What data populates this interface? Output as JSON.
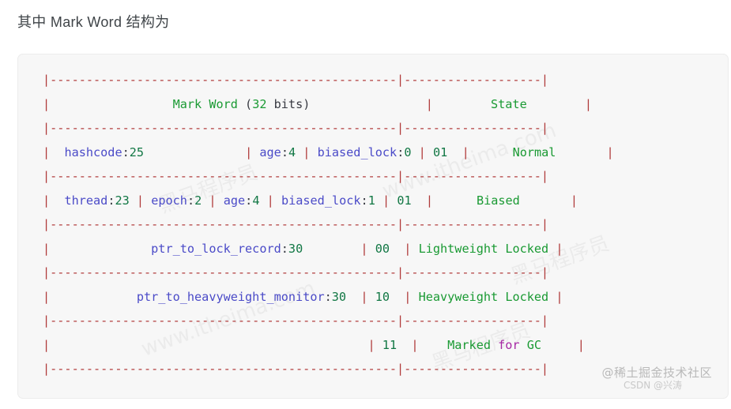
{
  "heading": "其中 Mark Word 结构为",
  "code_block": {
    "language": "text",
    "rule_char": "|",
    "separator_line": "|------------------------------------------------|-------------------|",
    "lines": [
      {
        "id": "rule-top",
        "type": "rule",
        "text": "|------------------------------------------------|-------------------|"
      },
      {
        "id": "header",
        "type": "content",
        "tokens": [
          {
            "text": "|",
            "color": "rule"
          },
          {
            "text": "                 ",
            "color": "punct"
          },
          {
            "text": "Mark Word ",
            "color": "str"
          },
          {
            "text": "(",
            "color": "punct"
          },
          {
            "text": "32",
            "color": "str"
          },
          {
            "text": " bits)",
            "color": "punct"
          },
          {
            "text": "                ",
            "color": "punct"
          },
          {
            "text": "|",
            "color": "rule"
          },
          {
            "text": "        ",
            "color": "punct"
          },
          {
            "text": "State",
            "color": "str"
          },
          {
            "text": "        ",
            "color": "punct"
          },
          {
            "text": "|",
            "color": "rule"
          }
        ]
      },
      {
        "id": "rule-1",
        "type": "rule",
        "text": "|------------------------------------------------|-------------------|"
      },
      {
        "id": "row-normal",
        "type": "content",
        "tokens": [
          {
            "text": "| ",
            "color": "rule"
          },
          {
            "text": " hashcode",
            "color": "ident"
          },
          {
            "text": ":",
            "color": "punct"
          },
          {
            "text": "25",
            "color": "num"
          },
          {
            "text": "              ",
            "color": "punct"
          },
          {
            "text": "|",
            "color": "rule"
          },
          {
            "text": " ",
            "color": "punct"
          },
          {
            "text": "age",
            "color": "ident"
          },
          {
            "text": ":",
            "color": "punct"
          },
          {
            "text": "4",
            "color": "num"
          },
          {
            "text": " ",
            "color": "punct"
          },
          {
            "text": "|",
            "color": "rule"
          },
          {
            "text": " ",
            "color": "punct"
          },
          {
            "text": "biased_lock",
            "color": "ident"
          },
          {
            "text": ":",
            "color": "punct"
          },
          {
            "text": "0",
            "color": "num"
          },
          {
            "text": " ",
            "color": "punct"
          },
          {
            "text": "|",
            "color": "rule"
          },
          {
            "text": " ",
            "color": "punct"
          },
          {
            "text": "01",
            "color": "num"
          },
          {
            "text": "  ",
            "color": "punct"
          },
          {
            "text": "|",
            "color": "rule"
          },
          {
            "text": "      ",
            "color": "punct"
          },
          {
            "text": "Normal",
            "color": "str"
          },
          {
            "text": "       ",
            "color": "punct"
          },
          {
            "text": "|",
            "color": "rule"
          }
        ]
      },
      {
        "id": "rule-2",
        "type": "rule",
        "text": "|------------------------------------------------|-------------------|"
      },
      {
        "id": "row-biased",
        "type": "content",
        "tokens": [
          {
            "text": "| ",
            "color": "rule"
          },
          {
            "text": " thread",
            "color": "ident"
          },
          {
            "text": ":",
            "color": "punct"
          },
          {
            "text": "23",
            "color": "num"
          },
          {
            "text": " ",
            "color": "punct"
          },
          {
            "text": "|",
            "color": "rule"
          },
          {
            "text": " ",
            "color": "punct"
          },
          {
            "text": "epoch",
            "color": "ident"
          },
          {
            "text": ":",
            "color": "punct"
          },
          {
            "text": "2",
            "color": "num"
          },
          {
            "text": " ",
            "color": "punct"
          },
          {
            "text": "|",
            "color": "rule"
          },
          {
            "text": " ",
            "color": "punct"
          },
          {
            "text": "age",
            "color": "ident"
          },
          {
            "text": ":",
            "color": "punct"
          },
          {
            "text": "4",
            "color": "num"
          },
          {
            "text": " ",
            "color": "punct"
          },
          {
            "text": "|",
            "color": "rule"
          },
          {
            "text": " ",
            "color": "punct"
          },
          {
            "text": "biased_lock",
            "color": "ident"
          },
          {
            "text": ":",
            "color": "punct"
          },
          {
            "text": "1",
            "color": "num"
          },
          {
            "text": " ",
            "color": "punct"
          },
          {
            "text": "|",
            "color": "rule"
          },
          {
            "text": " ",
            "color": "punct"
          },
          {
            "text": "01",
            "color": "num"
          },
          {
            "text": "  ",
            "color": "punct"
          },
          {
            "text": "|",
            "color": "rule"
          },
          {
            "text": "      ",
            "color": "punct"
          },
          {
            "text": "Biased",
            "color": "str"
          },
          {
            "text": "       ",
            "color": "punct"
          },
          {
            "text": "|",
            "color": "rule"
          }
        ]
      },
      {
        "id": "rule-3",
        "type": "rule",
        "text": "|------------------------------------------------|-------------------|"
      },
      {
        "id": "row-lightweight",
        "type": "content",
        "tokens": [
          {
            "text": "|",
            "color": "rule"
          },
          {
            "text": "          ",
            "color": "punct"
          },
          {
            "text": "    ptr_to_lock_record",
            "color": "ident"
          },
          {
            "text": ":",
            "color": "punct"
          },
          {
            "text": "30",
            "color": "num"
          },
          {
            "text": "        ",
            "color": "punct"
          },
          {
            "text": "|",
            "color": "rule"
          },
          {
            "text": " ",
            "color": "punct"
          },
          {
            "text": "00",
            "color": "num"
          },
          {
            "text": "  ",
            "color": "punct"
          },
          {
            "text": "|",
            "color": "rule"
          },
          {
            "text": " ",
            "color": "punct"
          },
          {
            "text": "Lightweight Locked",
            "color": "str"
          },
          {
            "text": " ",
            "color": "punct"
          },
          {
            "text": "|",
            "color": "rule"
          }
        ]
      },
      {
        "id": "rule-4",
        "type": "rule",
        "text": "|------------------------------------------------|-------------------|"
      },
      {
        "id": "row-heavyweight",
        "type": "content",
        "tokens": [
          {
            "text": "|",
            "color": "rule"
          },
          {
            "text": "          ",
            "color": "punct"
          },
          {
            "text": "  ptr_to_heavyweight_monitor",
            "color": "ident"
          },
          {
            "text": ":",
            "color": "punct"
          },
          {
            "text": "30",
            "color": "num"
          },
          {
            "text": "  ",
            "color": "punct"
          },
          {
            "text": "|",
            "color": "rule"
          },
          {
            "text": " ",
            "color": "punct"
          },
          {
            "text": "10",
            "color": "num"
          },
          {
            "text": "  ",
            "color": "punct"
          },
          {
            "text": "|",
            "color": "rule"
          },
          {
            "text": " ",
            "color": "punct"
          },
          {
            "text": "Heavyweight Locked",
            "color": "str"
          },
          {
            "text": " ",
            "color": "punct"
          },
          {
            "text": "|",
            "color": "rule"
          }
        ]
      },
      {
        "id": "rule-5",
        "type": "rule",
        "text": "|------------------------------------------------|-------------------|"
      },
      {
        "id": "row-gc",
        "type": "content",
        "tokens": [
          {
            "text": "|",
            "color": "rule"
          },
          {
            "text": "                                            ",
            "color": "punct"
          },
          {
            "text": "|",
            "color": "rule"
          },
          {
            "text": " ",
            "color": "punct"
          },
          {
            "text": "11",
            "color": "num"
          },
          {
            "text": "  ",
            "color": "punct"
          },
          {
            "text": "|",
            "color": "rule"
          },
          {
            "text": "    ",
            "color": "punct"
          },
          {
            "text": "Marked ",
            "color": "str"
          },
          {
            "text": "for",
            "color": "kw"
          },
          {
            "text": " GC",
            "color": "str"
          },
          {
            "text": "     ",
            "color": "punct"
          },
          {
            "text": "|",
            "color": "rule"
          }
        ]
      },
      {
        "id": "rule-bottom",
        "type": "rule",
        "text": "|------------------------------------------------|-------------------|"
      }
    ],
    "table_semantics": {
      "columns": [
        "Mark Word (32 bits)",
        "State"
      ],
      "rows": [
        {
          "mark_word": "hashcode:25 | age:4 | biased_lock:0 | 01",
          "state": "Normal"
        },
        {
          "mark_word": "thread:23 | epoch:2 | age:4 | biased_lock:1 | 01",
          "state": "Biased"
        },
        {
          "mark_word": "ptr_to_lock_record:30 | 00",
          "state": "Lightweight Locked"
        },
        {
          "mark_word": "ptr_to_heavyweight_monitor:30 | 10",
          "state": "Heavyweight Locked"
        },
        {
          "mark_word": "| 11",
          "state": "Marked for GC"
        }
      ]
    }
  },
  "watermarks": {
    "brand": "@稀土掘金技术社区",
    "csdn": "CSDN @兴涛",
    "diagonal": [
      "黑马程序员",
      "www.itheima.com",
      "黑马程序员",
      "www.itheima.com",
      "黑马程序员"
    ]
  },
  "colors": {
    "page_background": "#ffffff",
    "card_background": "#f7f7f7",
    "card_border": "#ececec",
    "heading_text": "#3f4448",
    "rule": "#b03a3a",
    "identifier": "#4b4bc8",
    "number": "#117744",
    "string": "#1a9a33",
    "punctuation": "#383a42",
    "keyword": "#a626a4",
    "watermark": "#b9b9b9"
  }
}
